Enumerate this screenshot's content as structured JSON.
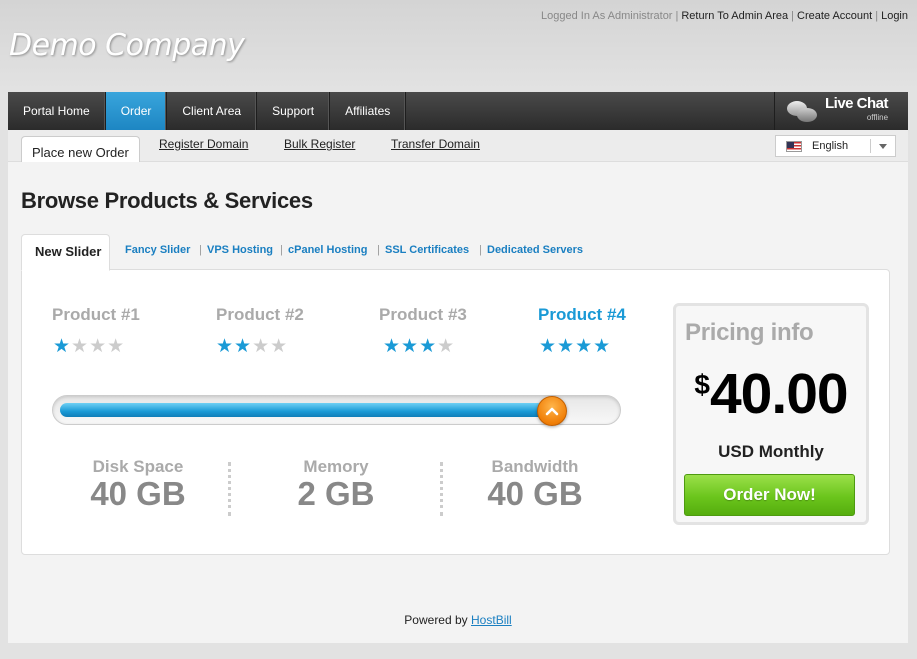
{
  "toplinks": {
    "logged_in": "Logged In As Administrator",
    "return_admin": "Return To Admin Area",
    "create_account": "Create Account",
    "login": "Login"
  },
  "logo": "Demo Company",
  "mainnav": {
    "items": [
      {
        "label": "Portal Home"
      },
      {
        "label": "Order"
      },
      {
        "label": "Client Area"
      },
      {
        "label": "Support"
      },
      {
        "label": "Affiliates"
      }
    ],
    "active": "Order",
    "livechat": {
      "label": "Live Chat",
      "status": "offline"
    }
  },
  "subnav": {
    "tabs": [
      "Place new Order",
      "Register Domain",
      "Bulk Register",
      "Transfer Domain"
    ],
    "active": "Place new Order",
    "language": "English"
  },
  "page": {
    "title": "Browse Products & Services",
    "slider_tabs": [
      "New Slider",
      "Fancy Slider",
      "VPS Hosting",
      "cPanel Hosting",
      "SSL Certificates",
      "Dedicated Servers"
    ],
    "active_tab": "New Slider"
  },
  "products": [
    {
      "name": "Product #1",
      "rating": 1,
      "max": 4
    },
    {
      "name": "Product #2",
      "rating": 2,
      "max": 4
    },
    {
      "name": "Product #3",
      "rating": 3,
      "max": 4
    },
    {
      "name": "Product #4",
      "rating": 4,
      "max": 4
    }
  ],
  "selected_product": "Product #4",
  "slider_value": 0.89,
  "specs": [
    {
      "label": "Disk Space",
      "value": "40 GB"
    },
    {
      "label": "Memory",
      "value": "2 GB"
    },
    {
      "label": "Bandwidth",
      "value": "40 GB"
    }
  ],
  "pricing": {
    "title": "Pricing info",
    "currency_symbol": "$",
    "amount": "40.00",
    "period": "USD Monthly",
    "order_button": "Order Now!"
  },
  "footer": {
    "text": "Powered by",
    "link": "HostBill"
  },
  "colors": {
    "accent": "#1a9ad6",
    "nav_active": "#2a95d0",
    "order_green": "#6bc51c",
    "knob_orange": "#f07f08"
  }
}
